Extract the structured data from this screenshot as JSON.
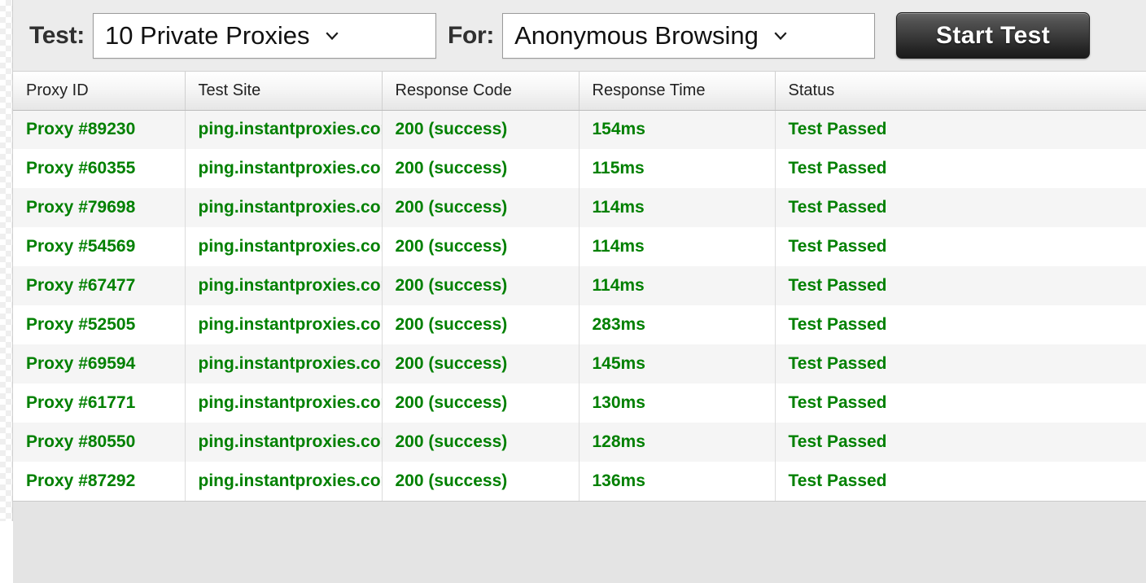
{
  "toolbar": {
    "test_label": "Test:",
    "proxy_select": {
      "value": "10 Private Proxies",
      "icon": "chevron-down-icon"
    },
    "for_label": "For:",
    "purpose_select": {
      "value": "Anonymous Browsing",
      "icon": "chevron-down-icon"
    },
    "start_button_label": "Start Test"
  },
  "table": {
    "columns": [
      "Proxy ID",
      "Test Site",
      "Response Code",
      "Response Time",
      "Status"
    ],
    "rows": [
      {
        "proxy_id": "Proxy #89230",
        "test_site": "ping.instantproxies.com",
        "response_code": "200 (success)",
        "response_time": "154ms",
        "status": "Test Passed"
      },
      {
        "proxy_id": "Proxy #60355",
        "test_site": "ping.instantproxies.com",
        "response_code": "200 (success)",
        "response_time": "115ms",
        "status": "Test Passed"
      },
      {
        "proxy_id": "Proxy #79698",
        "test_site": "ping.instantproxies.com",
        "response_code": "200 (success)",
        "response_time": "114ms",
        "status": "Test Passed"
      },
      {
        "proxy_id": "Proxy #54569",
        "test_site": "ping.instantproxies.com",
        "response_code": "200 (success)",
        "response_time": "114ms",
        "status": "Test Passed"
      },
      {
        "proxy_id": "Proxy #67477",
        "test_site": "ping.instantproxies.com",
        "response_code": "200 (success)",
        "response_time": "114ms",
        "status": "Test Passed"
      },
      {
        "proxy_id": "Proxy #52505",
        "test_site": "ping.instantproxies.com",
        "response_code": "200 (success)",
        "response_time": "283ms",
        "status": "Test Passed"
      },
      {
        "proxy_id": "Proxy #69594",
        "test_site": "ping.instantproxies.com",
        "response_code": "200 (success)",
        "response_time": "145ms",
        "status": "Test Passed"
      },
      {
        "proxy_id": "Proxy #61771",
        "test_site": "ping.instantproxies.com",
        "response_code": "200 (success)",
        "response_time": "130ms",
        "status": "Test Passed"
      },
      {
        "proxy_id": "Proxy #80550",
        "test_site": "ping.instantproxies.com",
        "response_code": "200 (success)",
        "response_time": "128ms",
        "status": "Test Passed"
      },
      {
        "proxy_id": "Proxy #87292",
        "test_site": "ping.instantproxies.com",
        "response_code": "200 (success)",
        "response_time": "136ms",
        "status": "Test Passed"
      }
    ]
  },
  "colors": {
    "success_text": "#008000",
    "toolbar_background": "#ececec",
    "row_alt_background": "#f5f5f5",
    "button_text": "#ffffff"
  }
}
